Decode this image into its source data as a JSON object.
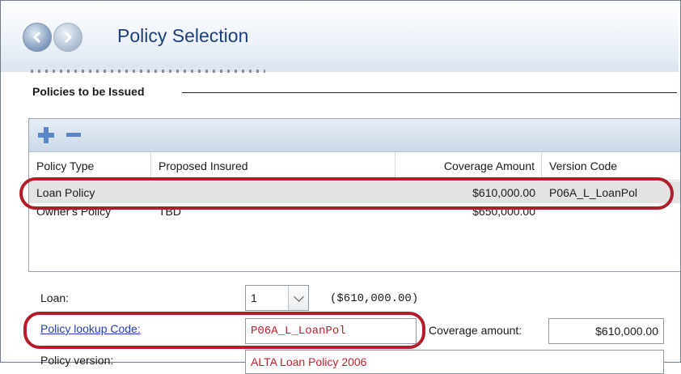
{
  "header": {
    "title": "Policy Selection"
  },
  "section": {
    "title": "Policies to be Issued"
  },
  "grid": {
    "columns": [
      "Policy Type",
      "Proposed Insured",
      "Coverage Amount",
      "Version Code"
    ],
    "rows": [
      {
        "policy_type": "Loan Policy",
        "proposed_insured": "",
        "coverage_amount": "$610,000.00",
        "version_code": "P06A_L_LoanPol"
      },
      {
        "policy_type": "Owner's Policy",
        "proposed_insured": "TBD",
        "coverage_amount": "$650,000.00",
        "version_code": ""
      }
    ]
  },
  "form": {
    "loan_label": "Loan:",
    "loan_value": "1",
    "loan_amount": "($610,000.00)",
    "lookup_label": "Policy lookup Code:",
    "lookup_value": "P06A_L_LoanPol",
    "coverage_label": "Coverage amount:",
    "coverage_value": "$610,000.00",
    "version_label": "Policy version:",
    "version_value": "ALTA Loan Policy 2006"
  },
  "colors": {
    "highlight": "#b21c2b",
    "title": "#1e3f7a",
    "link": "#1f3fbf",
    "red_text": "#c0202c"
  },
  "icons": [
    "back-icon",
    "forward-icon",
    "add-icon",
    "remove-icon",
    "chevron-down-icon"
  ]
}
